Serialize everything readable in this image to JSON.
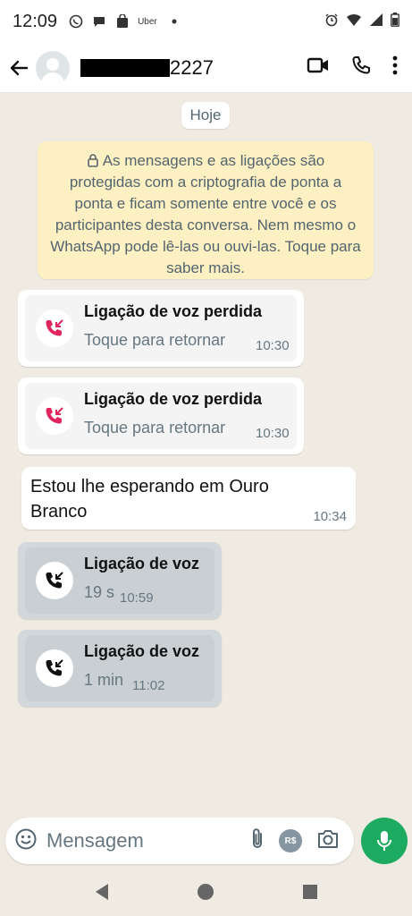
{
  "status_bar": {
    "time": "12:09",
    "notif_text": "Uber"
  },
  "header": {
    "contact_suffix": "2227"
  },
  "chat": {
    "date_chip": "Hoje",
    "encryption_notice": "As mensagens e as ligações são protegidas com a criptografia de ponta a ponta e ficam somente entre você e os participantes desta conversa. Nem mesmo o WhatsApp pode lê-las ou ouvi-las. Toque para saber mais.",
    "messages": [
      {
        "type": "missed-call",
        "title": "Ligação de voz perdida",
        "subtitle": "Toque para retornar",
        "time": "10:30"
      },
      {
        "type": "missed-call",
        "title": "Ligação de voz perdida",
        "subtitle": "Toque para retornar",
        "time": "10:30"
      },
      {
        "type": "text",
        "text": "Estou lhe esperando em Ouro Branco",
        "time": "10:34"
      },
      {
        "type": "voice-call",
        "title": "Ligação de voz",
        "subtitle": "19 s",
        "time": "10:59"
      },
      {
        "type": "voice-call",
        "title": "Ligação de voz",
        "subtitle": "1 min",
        "time": "11:02"
      }
    ]
  },
  "input": {
    "placeholder": "Mensagem",
    "pay_label": "R$"
  },
  "colors": {
    "missed_call_red": "#e0245e",
    "accent_green": "#1daa61",
    "encryption_bg": "#fdf0c2",
    "chat_bg": "#efeae2"
  }
}
